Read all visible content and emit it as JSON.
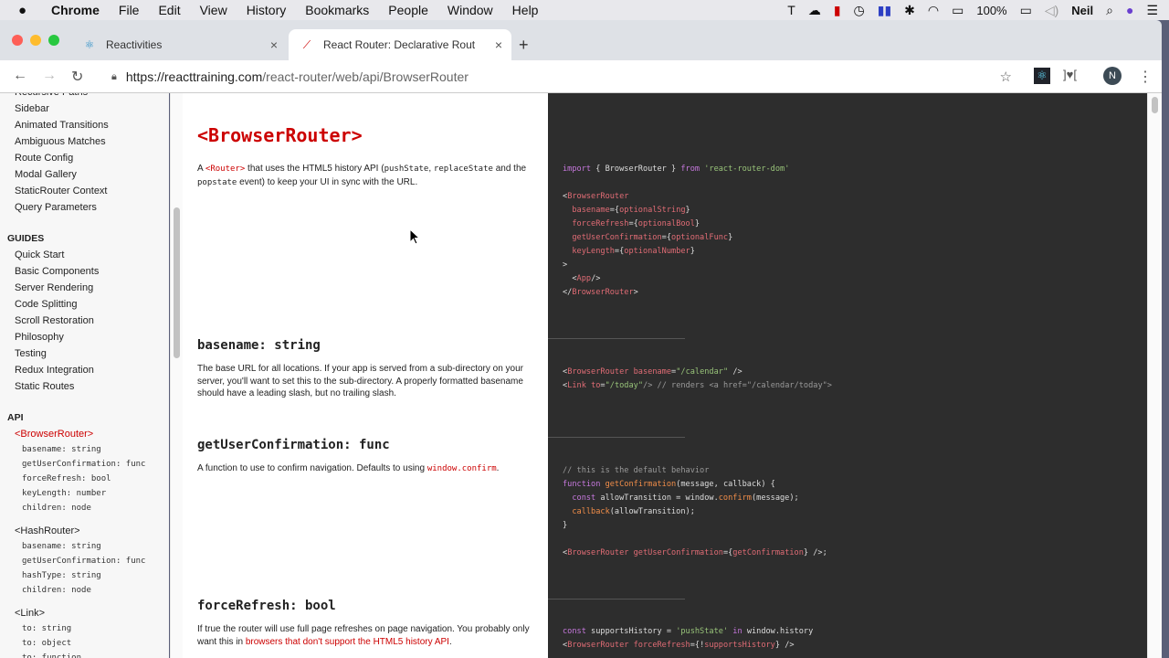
{
  "menubar": {
    "app": "Chrome",
    "items": [
      "File",
      "Edit",
      "View",
      "History",
      "Bookmarks",
      "People",
      "Window",
      "Help"
    ],
    "battery": "100%",
    "user": "Neil"
  },
  "tabs": [
    {
      "label": "Reactivities"
    },
    {
      "label": "React Router: Declarative Rout"
    }
  ],
  "url": {
    "host": "https://reacttraining.com",
    "path": "/react-router/web/api/BrowserRouter"
  },
  "profile_initial": "N",
  "sidebar": {
    "examples": [
      "Recursive Paths",
      "Sidebar",
      "Animated Transitions",
      "Ambiguous Matches",
      "Route Config",
      "Modal Gallery",
      "StaticRouter Context",
      "Query Parameters"
    ],
    "guides_heading": "GUIDES",
    "guides": [
      "Quick Start",
      "Basic Components",
      "Server Rendering",
      "Code Splitting",
      "Scroll Restoration",
      "Philosophy",
      "Testing",
      "Redux Integration",
      "Static Routes"
    ],
    "api_heading": "API",
    "api": [
      {
        "label": "<BrowserRouter>",
        "active": true,
        "subs": [
          "basename: string",
          "getUserConfirmation: func",
          "forceRefresh: bool",
          "keyLength: number",
          "children: node"
        ]
      },
      {
        "label": "<HashRouter>",
        "subs": [
          "basename: string",
          "getUserConfirmation: func",
          "hashType: string",
          "children: node"
        ]
      },
      {
        "label": "<Link>",
        "subs": [
          "to: string",
          "to: object",
          "to: function"
        ]
      }
    ]
  },
  "doc": {
    "title": "<BrowserRouter>",
    "intro": {
      "a": "A ",
      "router": "<Router>",
      "b": " that uses the HTML5 history API (",
      "push": "pushState",
      "c": ", ",
      "replace": "replaceState",
      "d": " and the ",
      "pop": "popstate",
      "e": " event) to keep your UI in sync with the URL."
    },
    "basename": {
      "title": "basename: string",
      "text": "The base URL for all locations. If your app is served from a sub-directory on your server, you'll want to set this to the sub-directory. A properly formatted basename should have a leading slash, but no trailing slash."
    },
    "getUserConfirmation": {
      "title": "getUserConfirmation: func",
      "text": "A function to use to confirm navigation. Defaults to using ",
      "code": "window.confirm",
      "end": "."
    },
    "forceRefresh": {
      "title": "forceRefresh: bool",
      "text": "If true the router will use full page refreshes on page navigation. You probably only want this in ",
      "link": "browsers that don't support the HTML5 history API",
      "end": "."
    }
  },
  "code": [
    [
      [
        [
          "import",
          "kw"
        ],
        [
          " { BrowserRouter } ",
          "pl"
        ],
        [
          "from",
          "kw"
        ],
        [
          " 'react-router-dom'",
          "str"
        ]
      ],
      [],
      [
        [
          "<",
          "pl"
        ],
        [
          "BrowserRouter",
          "tag"
        ]
      ],
      [
        [
          "  basename",
          "attr"
        ],
        [
          "={",
          "pl"
        ],
        [
          "optionalString",
          "var"
        ],
        [
          "}",
          "pl"
        ]
      ],
      [
        [
          "  forceRefresh",
          "attr"
        ],
        [
          "={",
          "pl"
        ],
        [
          "optionalBool",
          "var"
        ],
        [
          "}",
          "pl"
        ]
      ],
      [
        [
          "  getUserConfirmation",
          "attr"
        ],
        [
          "={",
          "pl"
        ],
        [
          "optionalFunc",
          "var"
        ],
        [
          "}",
          "pl"
        ]
      ],
      [
        [
          "  keyLength",
          "attr"
        ],
        [
          "={",
          "pl"
        ],
        [
          "optionalNumber",
          "var"
        ],
        [
          "}",
          "pl"
        ]
      ],
      [
        [
          ">",
          "pl"
        ]
      ],
      [
        [
          "  <",
          "pl"
        ],
        [
          "App",
          "tag"
        ],
        [
          "/>",
          "pl"
        ]
      ],
      [
        [
          "</",
          "pl"
        ],
        [
          "BrowserRouter",
          "tag"
        ],
        [
          ">",
          "pl"
        ]
      ]
    ],
    [
      [
        [
          "<",
          "pl"
        ],
        [
          "BrowserRouter",
          "tag"
        ],
        [
          " basename",
          "attr"
        ],
        [
          "=",
          "pl"
        ],
        [
          "\"/calendar\"",
          "str"
        ],
        [
          " />",
          "pl"
        ]
      ],
      [
        [
          "<",
          "pl"
        ],
        [
          "Link",
          "tag"
        ],
        [
          " to",
          "attr"
        ],
        [
          "=",
          "pl"
        ],
        [
          "\"/today\"",
          "str"
        ],
        [
          "/> // renders <a href=\"/calendar/today\">",
          "cm"
        ]
      ]
    ],
    [
      [
        [
          "// this is the default behavior",
          "cm"
        ]
      ],
      [
        [
          "function",
          "kw"
        ],
        [
          " getConfirmation",
          "fn"
        ],
        [
          "(message, callback) {",
          "pl"
        ]
      ],
      [
        [
          "  const",
          "kw"
        ],
        [
          " allowTransition = window.",
          "pl"
        ],
        [
          "confirm",
          "fn"
        ],
        [
          "(message);",
          "pl"
        ]
      ],
      [
        [
          "  callback",
          "fn"
        ],
        [
          "(allowTransition);",
          "pl"
        ]
      ],
      [
        [
          "}",
          "pl"
        ]
      ],
      [],
      [
        [
          "<",
          "pl"
        ],
        [
          "BrowserRouter",
          "tag"
        ],
        [
          " getUserConfirmation",
          "attr"
        ],
        [
          "={",
          "pl"
        ],
        [
          "getConfirmation",
          "var"
        ],
        [
          "} />;",
          "pl"
        ]
      ]
    ],
    [
      [
        [
          "const",
          "kw"
        ],
        [
          " supportsHistory = ",
          "pl"
        ],
        [
          "'pushState'",
          "str"
        ],
        [
          " in",
          "kw"
        ],
        [
          " window.history",
          "pl"
        ]
      ],
      [
        [
          "<",
          "pl"
        ],
        [
          "BrowserRouter",
          "tag"
        ],
        [
          " forceRefresh",
          "attr"
        ],
        [
          "={!",
          "pl"
        ],
        [
          "supportsHistory",
          "var"
        ],
        [
          "} />",
          "pl"
        ]
      ]
    ]
  ]
}
